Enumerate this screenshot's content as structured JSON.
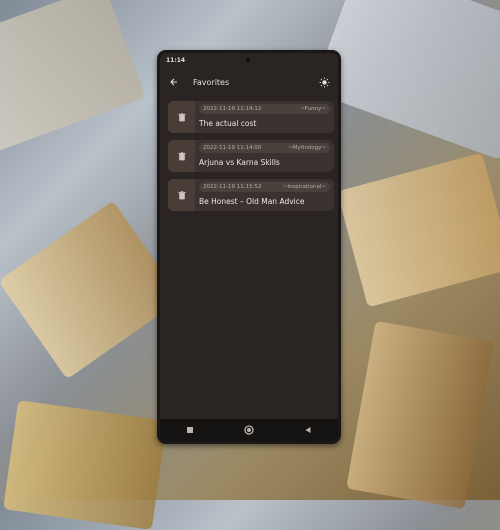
{
  "status": {
    "time": "11:14"
  },
  "appbar": {
    "title": "Favorites",
    "back_icon": "arrow-left-icon",
    "theme_icon": "sun-icon"
  },
  "favorites": [
    {
      "timestamp": "2022-11-19 11:14:12",
      "category": "~Funny~",
      "title": "The actual cost"
    },
    {
      "timestamp": "2022-11-19 11:14:00",
      "category": "~Mythology~",
      "title": "Arjuna vs Karna Skills"
    },
    {
      "timestamp": "2022-11-19 11:15:52",
      "category": "~Inspirational~",
      "title": "Be Honest – Old Man Advice"
    }
  ],
  "navbar": {
    "icons": [
      "square-icon",
      "circle-icon",
      "triangle-back-icon"
    ]
  }
}
